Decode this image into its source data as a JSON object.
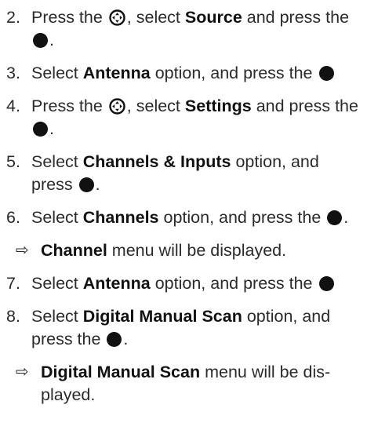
{
  "steps": [
    {
      "num": "2.",
      "parts": [
        {
          "t": "text",
          "v": "Press the "
        },
        {
          "t": "icon",
          "v": "navigation-icon"
        },
        {
          "t": "text",
          "v": ", select "
        },
        {
          "t": "bold",
          "v": "Source"
        },
        {
          "t": "text",
          "v": " and press the "
        },
        {
          "t": "icon",
          "v": "ok-button-icon"
        },
        {
          "t": "text",
          "v": "."
        }
      ]
    },
    {
      "num": "3.",
      "parts": [
        {
          "t": "text",
          "v": "Select "
        },
        {
          "t": "bold",
          "v": "Antenna"
        },
        {
          "t": "text",
          "v": " option, and press the "
        },
        {
          "t": "icon",
          "v": "ok-button-icon"
        }
      ]
    },
    {
      "num": "4.",
      "parts": [
        {
          "t": "text",
          "v": "Press the "
        },
        {
          "t": "icon",
          "v": "navigation-icon"
        },
        {
          "t": "text",
          "v": ", select "
        },
        {
          "t": "bold",
          "v": "Settings"
        },
        {
          "t": "text",
          "v": " and press the "
        },
        {
          "t": "icon",
          "v": "ok-button-icon"
        },
        {
          "t": "text",
          "v": "."
        }
      ]
    },
    {
      "num": "5.",
      "parts": [
        {
          "t": "text",
          "v": "Select "
        },
        {
          "t": "bold",
          "v": "Channels & Inputs"
        },
        {
          "t": "text",
          "v": " option, and press "
        },
        {
          "t": "icon",
          "v": "ok-button-icon"
        },
        {
          "t": "text",
          "v": "."
        }
      ]
    },
    {
      "num": "6.",
      "parts": [
        {
          "t": "text",
          "v": "Select "
        },
        {
          "t": "bold",
          "v": "Channels"
        },
        {
          "t": "text",
          "v": " option, and press the "
        },
        {
          "t": "icon",
          "v": "ok-button-icon"
        },
        {
          "t": "text",
          "v": "."
        }
      ],
      "result": [
        {
          "t": "bold",
          "v": "Channel"
        },
        {
          "t": "text",
          "v": " menu will be displayed."
        }
      ]
    },
    {
      "num": "7.",
      "parts": [
        {
          "t": "text",
          "v": "Select "
        },
        {
          "t": "bold",
          "v": "Antenna"
        },
        {
          "t": "text",
          "v": " option, and press the "
        },
        {
          "t": "icon",
          "v": "ok-button-icon"
        }
      ]
    },
    {
      "num": "8.",
      "parts": [
        {
          "t": "text",
          "v": "Select "
        },
        {
          "t": "bold",
          "v": "Digital Manual Scan"
        },
        {
          "t": "text",
          "v": " option, and press the "
        },
        {
          "t": "icon",
          "v": "ok-button-icon"
        },
        {
          "t": "text",
          "v": "."
        }
      ],
      "result": [
        {
          "t": "bold",
          "v": "Digital Manual Scan"
        },
        {
          "t": "text",
          "v": " menu will be dis-played."
        }
      ]
    }
  ],
  "result_arrow": "⇨"
}
